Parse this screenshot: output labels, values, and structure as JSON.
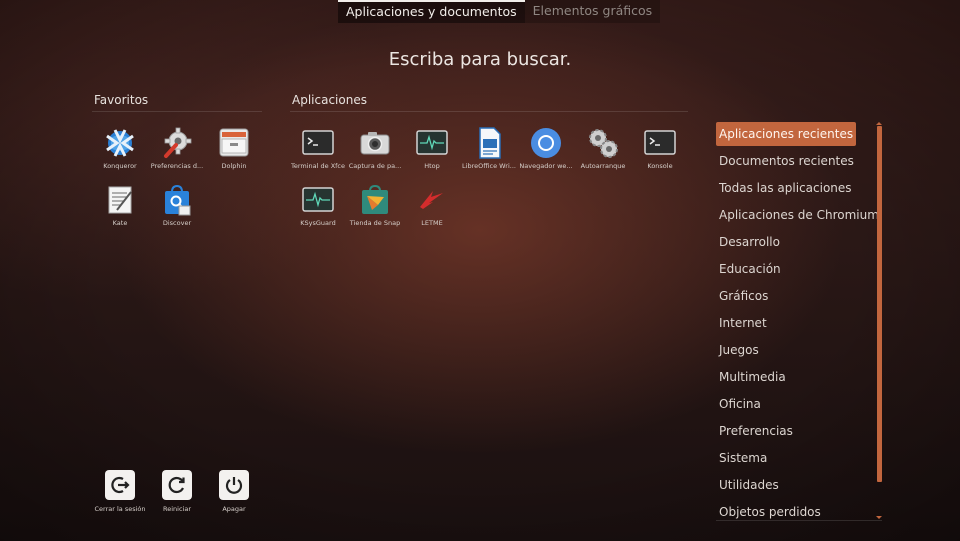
{
  "tabs": [
    {
      "label": "Aplicaciones y documentos",
      "active": true
    },
    {
      "label": "Elementos gráficos",
      "active": false
    }
  ],
  "search_hint": "Escriba para buscar.",
  "favorites": {
    "title": "Favoritos",
    "items": [
      {
        "label": "Konqueror",
        "icon": "konqueror-icon"
      },
      {
        "label": "Preferencias d...",
        "icon": "preferences-icon"
      },
      {
        "label": "Dolphin",
        "icon": "dolphin-icon"
      },
      {
        "label": "Kate",
        "icon": "kate-icon"
      },
      {
        "label": "Discover",
        "icon": "discover-icon"
      }
    ]
  },
  "applications": {
    "title": "Aplicaciones",
    "items": [
      {
        "label": "Terminal de Xfce",
        "icon": "terminal-icon"
      },
      {
        "label": "Captura de pa...",
        "icon": "screenshot-icon"
      },
      {
        "label": "Htop",
        "icon": "htop-icon"
      },
      {
        "label": "LibreOffice Wri...",
        "icon": "libreoffice-writer-icon"
      },
      {
        "label": "Navegador we...",
        "icon": "chromium-icon"
      },
      {
        "label": "Autoarranque",
        "icon": "autostart-icon"
      },
      {
        "label": "Konsole",
        "icon": "konsole-icon"
      },
      {
        "label": "KSysGuard",
        "icon": "ksysguard-icon"
      },
      {
        "label": "Tienda de Snap",
        "icon": "snap-store-icon"
      },
      {
        "label": "LETME",
        "icon": "letme-icon"
      }
    ]
  },
  "power": [
    {
      "label": "Cerrar la sesión",
      "icon": "logout-icon"
    },
    {
      "label": "Reiniciar",
      "icon": "restart-icon"
    },
    {
      "label": "Apagar",
      "icon": "shutdown-icon"
    }
  ],
  "categories": [
    {
      "label": "Aplicaciones recientes",
      "active": true
    },
    {
      "label": "Documentos recientes"
    },
    {
      "label": "Todas las aplicaciones"
    },
    {
      "label": "Aplicaciones de Chromium"
    },
    {
      "label": "Desarrollo"
    },
    {
      "label": "Educación"
    },
    {
      "label": "Gráficos"
    },
    {
      "label": "Internet"
    },
    {
      "label": "Juegos"
    },
    {
      "label": "Multimedia"
    },
    {
      "label": "Oficina"
    },
    {
      "label": "Preferencias"
    },
    {
      "label": "Sistema"
    },
    {
      "label": "Utilidades"
    },
    {
      "label": "Objetos perdidos"
    }
  ],
  "colors": {
    "accent": "#c2663e"
  }
}
